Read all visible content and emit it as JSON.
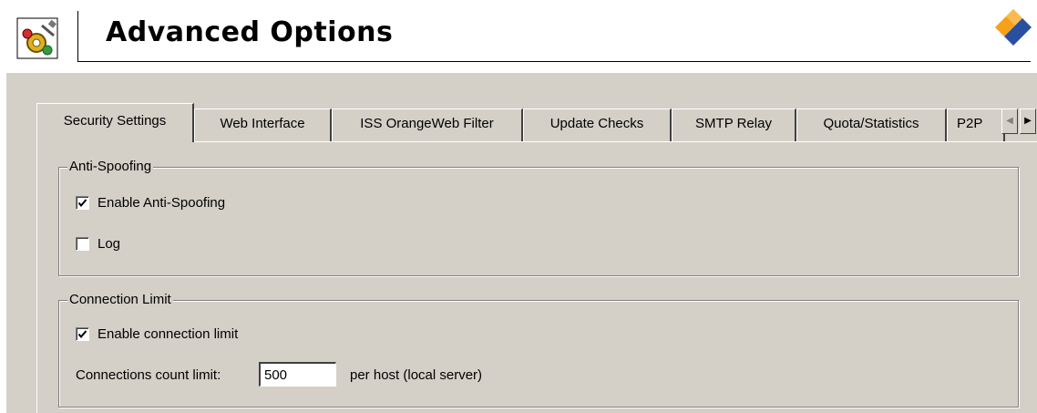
{
  "header": {
    "title": "Advanced Options"
  },
  "tabs": [
    {
      "label": "Security Settings",
      "active": true
    },
    {
      "label": "Web Interface",
      "active": false
    },
    {
      "label": "ISS OrangeWeb Filter",
      "active": false
    },
    {
      "label": "Update Checks",
      "active": false
    },
    {
      "label": "SMTP Relay",
      "active": false
    },
    {
      "label": "Quota/Statistics",
      "active": false
    },
    {
      "label": "P2P",
      "active": false
    }
  ],
  "tab_scroll": {
    "left": "◀",
    "right": "▶"
  },
  "anti_spoofing": {
    "legend": "Anti-Spoofing",
    "enable_label": "Enable Anti-Spoofing",
    "enable_checked": true,
    "log_label": "Log",
    "log_checked": false
  },
  "connection_limit": {
    "legend": "Connection Limit",
    "enable_label": "Enable connection limit",
    "enable_checked": true,
    "count_label": "Connections count limit:",
    "count_value": "500",
    "suffix": "per host (local server)"
  },
  "icons": {
    "app": "settings-gear-icon",
    "brand": "brand-logo-icon"
  },
  "colors": {
    "dialog_bg": "#d4d0c8",
    "brand_orange": "#f7a01c",
    "brand_blue": "#2b4fa0"
  }
}
